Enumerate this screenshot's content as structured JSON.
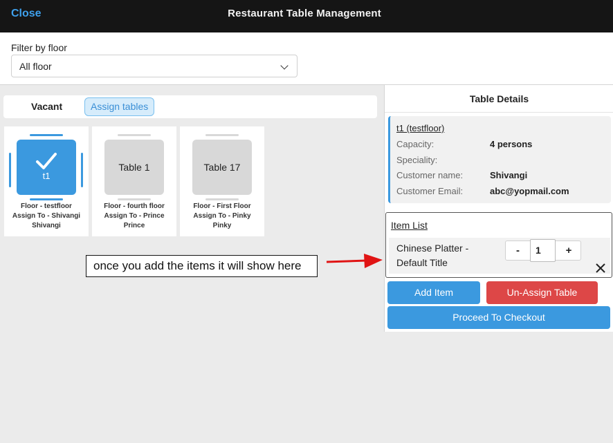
{
  "header": {
    "close_label": "Close",
    "title": "Restaurant Table Management"
  },
  "filter": {
    "label": "Filter by floor",
    "selected": "All floor"
  },
  "tabs": {
    "vacant": "Vacant",
    "assign": "Assign tables"
  },
  "tables": [
    {
      "name": "t1",
      "floor": "Floor - testfloor",
      "assign": "Assign To - Shivangi",
      "customer": "Shivangi",
      "selected": true
    },
    {
      "name": "Table 1",
      "floor": "Floor - fourth floor",
      "assign": "Assign To - Prince",
      "customer": "Prince",
      "selected": false
    },
    {
      "name": "Table 17",
      "floor": "Floor - First Floor",
      "assign": "Assign To - Pinky",
      "customer": "Pinky",
      "selected": false
    }
  ],
  "annotation": {
    "text": "once you add the items it will show here"
  },
  "details": {
    "title": "Table Details",
    "table_ref": "t1 (testfloor)",
    "rows": [
      {
        "key": "Capacity:",
        "value": "4 persons"
      },
      {
        "key": "Speciality:",
        "value": ""
      },
      {
        "key": "Customer name:",
        "value": "Shivangi"
      },
      {
        "key": "Customer Email:",
        "value": "abc@yopmail.com"
      }
    ]
  },
  "items": {
    "title": "Item List",
    "list": [
      {
        "name": "Chinese Platter - Default Title",
        "quantity": "1",
        "minus": "-",
        "plus": "+"
      }
    ]
  },
  "actions": {
    "add_item": "Add Item",
    "unassign": "Un-Assign Table",
    "checkout": "Proceed To Checkout"
  },
  "colors": {
    "accent": "#3b99df",
    "danger": "#dd4747",
    "topbar": "#151515"
  }
}
